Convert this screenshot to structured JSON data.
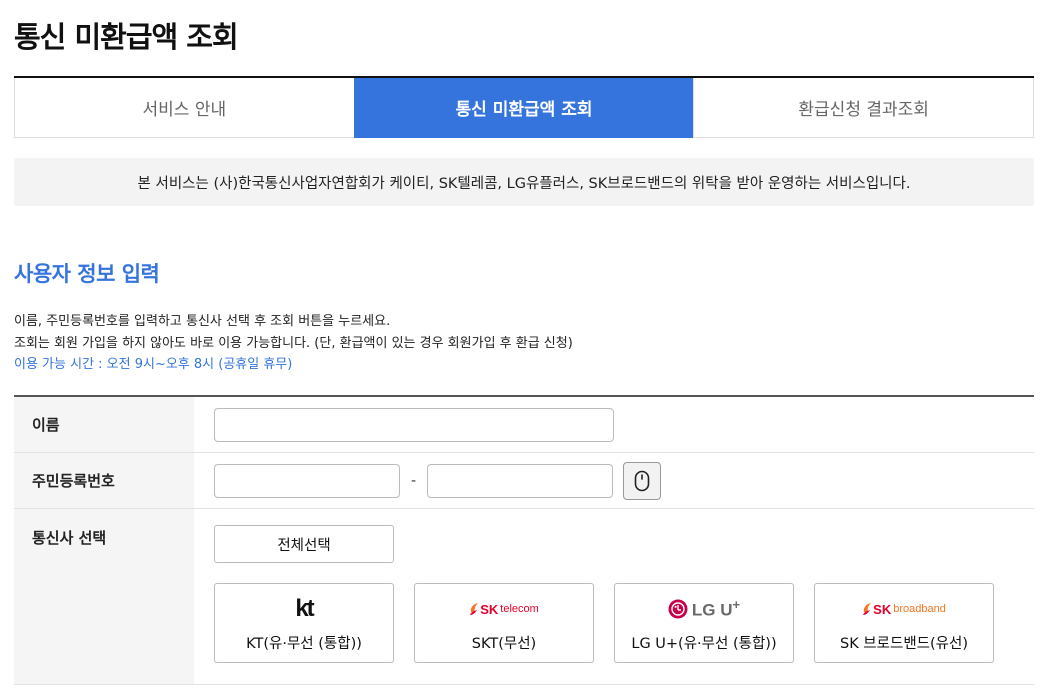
{
  "page": {
    "title": "통신 미환급액 조회"
  },
  "tabs": [
    {
      "label": "서비스 안내",
      "active": false
    },
    {
      "label": "통신 미환급액 조회",
      "active": true
    },
    {
      "label": "환급신청 결과조회",
      "active": false
    }
  ],
  "notice": "본 서비스는 (사)한국통신사업자연합회가 케이티, SK텔레콤, LG유플러스, SK브로드밴드의 위탁을 받아 운영하는 서비스입니다.",
  "section": {
    "title": "사용자 정보 입력",
    "desc_line1": "이름, 주민등록번호를 입력하고 통신사 선택 후 조회 버튼을 누르세요.",
    "desc_line2": "조회는 회원 가입을 하지 않아도 바로 이용 가능합니다. (단, 환급액이 있는 경우 회원가입 후 환급 신청)",
    "hours": "이용 가능 시간 : 오전 9시~오후 8시 (공휴일 휴무)"
  },
  "form": {
    "name_label": "이름",
    "name_value": "",
    "rrn_label": "주민등록번호",
    "rrn_front": "",
    "rrn_separator": "-",
    "rrn_back": "",
    "keypad_icon": "mouse-icon",
    "carrier_label": "통신사 선택",
    "select_all": "전체선택"
  },
  "carriers": [
    {
      "name": "KT(유·무선 (통합))",
      "logo_text": "kt",
      "logo_icon": "kt-logo"
    },
    {
      "name": "SKT(무선)",
      "logo_mark": "SK",
      "logo_sub": "telecom",
      "logo_icon": "sk-telecom-logo"
    },
    {
      "name": "LG U+(유·무선 (통합))",
      "logo_text": "LG U",
      "logo_plus": "+",
      "logo_icon": "lg-uplus-logo"
    },
    {
      "name": "SK 브로드밴드(유선)",
      "logo_mark": "SK",
      "logo_sub": "broadband",
      "logo_icon": "sk-broadband-logo"
    }
  ],
  "colors": {
    "accent": "#3474dc",
    "sk_red": "#e4002b",
    "sk_orange": "#f47725",
    "lg_red": "#c6004a"
  }
}
